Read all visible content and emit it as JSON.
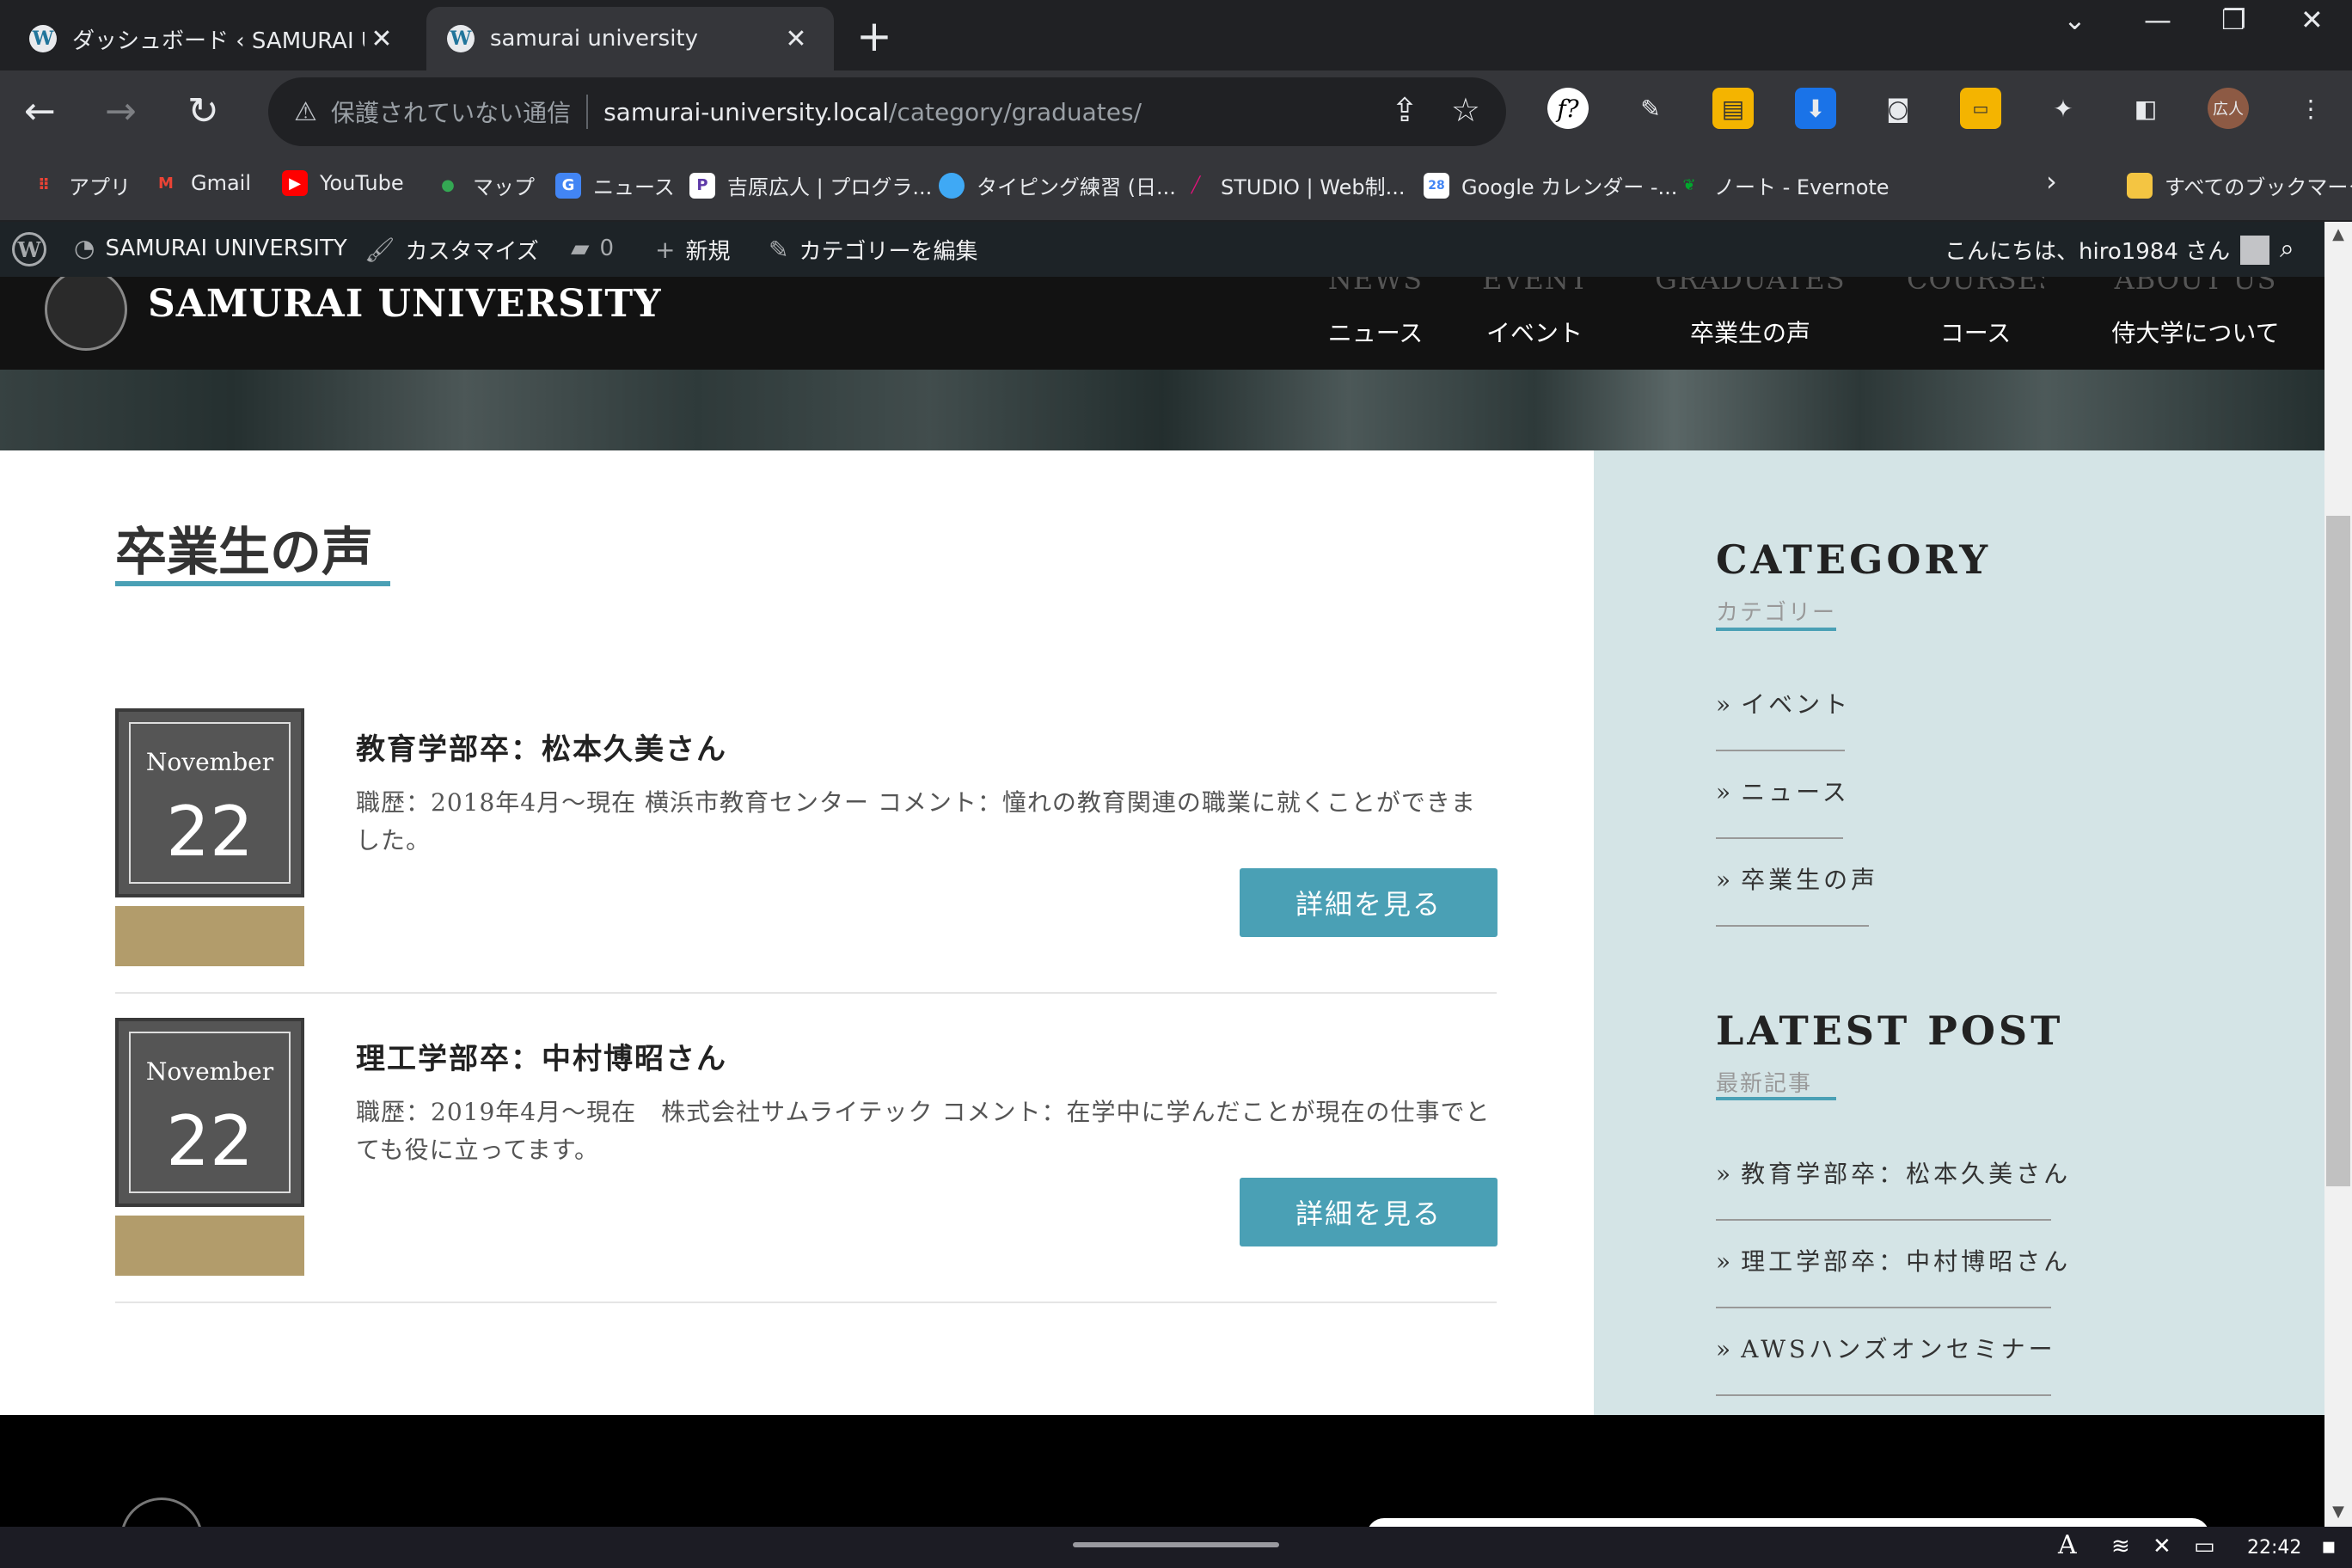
{
  "browser": {
    "tabs": [
      {
        "title": "ダッシュボード ‹ SAMURAI UNIV",
        "close": "✕"
      },
      {
        "title": "samurai university",
        "close": "✕"
      }
    ],
    "new_tab": "+",
    "insecure_label": "保護されていない通信",
    "url_host": "samurai-university.local",
    "url_path": "/category/graduates/",
    "profile_initials": "広人"
  },
  "bookmarks": [
    {
      "label": "アプリ",
      "icon": "apps-grid-icon",
      "color": "#ea4335"
    },
    {
      "label": "Gmail",
      "icon": "gmail-icon",
      "color": "#ea4335"
    },
    {
      "label": "YouTube",
      "icon": "youtube-icon",
      "color": "#ff0000"
    },
    {
      "label": "マップ",
      "icon": "maps-pin-icon",
      "color": "#34a853"
    },
    {
      "label": "ニュース",
      "icon": "news-icon",
      "color": "#4285f4"
    },
    {
      "label": "吉原広人 | プログラ...",
      "icon": "profile-p-icon",
      "color": "#5e3aa8"
    },
    {
      "label": "タイピング練習 (日...",
      "icon": "typing-icon",
      "color": "#3fa9f5"
    },
    {
      "label": "STUDIO | Web制...",
      "icon": "studio-slash-icon",
      "color": "#e0137a"
    },
    {
      "label": "Google カレンダー -...",
      "icon": "calendar-icon",
      "color": "#4285f4"
    },
    {
      "label": "ノート - Evernote",
      "icon": "evernote-icon",
      "color": "#00a82d"
    }
  ],
  "bookmarks_all": "すべてのブックマーク",
  "adminbar": {
    "site_name": "SAMURAI UNIVERSITY",
    "customize": "カスタマイズ",
    "comments": "0",
    "new": "新規",
    "edit_category": "カテゴリーを編集",
    "greeting": "こんにちは、hiro1984 さん"
  },
  "site": {
    "title": "SAMURAI UNIVERSITY",
    "nav": [
      {
        "en": "NEWS",
        "ja": "ニュース"
      },
      {
        "en": "EVENT",
        "ja": "イベント"
      },
      {
        "en": "GRADUATES",
        "ja": "卒業生の声"
      },
      {
        "en": "COURSES",
        "ja": "コース"
      },
      {
        "en": "ABOUT US",
        "ja": "侍大学について"
      }
    ]
  },
  "page": {
    "heading": "卒業生の声",
    "posts": [
      {
        "month": "November",
        "day": "22",
        "title": "教育学部卒：松本久美さん",
        "excerpt": "職歴：2018年4月～現在 横浜市教育センター コメント：憧れの教育関連の職業に就くことができました。",
        "button": "詳細を見る"
      },
      {
        "month": "November",
        "day": "22",
        "title": "理工学部卒：中村博昭さん",
        "excerpt": "職歴：2019年4月～現在　株式会社サムライテック コメント：在学中に学んだことが現在の仕事でとても役に立ってます。",
        "button": "詳細を見る"
      }
    ]
  },
  "sidebar": {
    "category_title": "CATEGORY",
    "category_sub": "カテゴリー",
    "categories": [
      "イベント",
      "ニュース",
      "卒業生の声"
    ],
    "latest_title": "LATEST POST",
    "latest_sub": "最新記事",
    "latest": [
      "教育学部卒：松本久美さん",
      "理工学部卒：中村博昭さん",
      "AWSハンズオンセミナー"
    ]
  },
  "taskbar": {
    "ime": "A",
    "time": "22:42"
  }
}
